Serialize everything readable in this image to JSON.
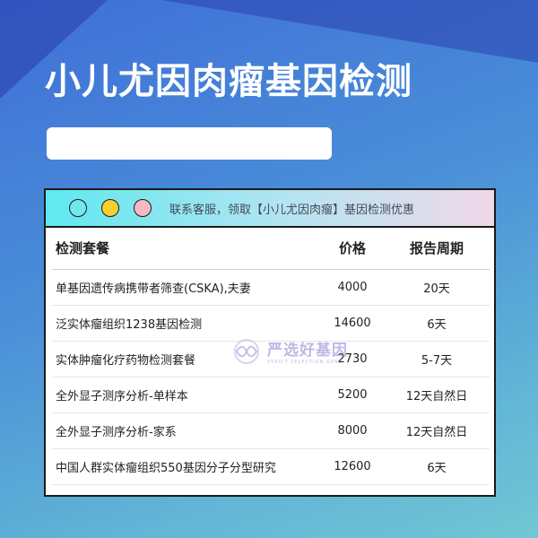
{
  "page": {
    "title": "小儿尤因肉瘤基因检测",
    "subtitle": ""
  },
  "card": {
    "header_text": "联系客服，领取【小儿尤因肉瘤】基因检测优惠",
    "table": {
      "headers": [
        "检测套餐",
        "价格",
        "报告周期"
      ],
      "rows": [
        [
          "单基因遗传病携带者筛查(CSKA),夫妻",
          "4000",
          "20天"
        ],
        [
          "泛实体瘤组织1238基因检测",
          "14600",
          "6天"
        ],
        [
          "实体肿瘤化疗药物检测套餐",
          "2730",
          "5-7天"
        ],
        [
          "全外显子测序分析-单样本",
          "5200",
          "12天自然日"
        ],
        [
          "全外显子测序分析-家系",
          "8000",
          "12天自然日"
        ],
        [
          "中国人群实体瘤组织550基因分子分型研究",
          "12600",
          "6天"
        ]
      ]
    }
  },
  "watermark": {
    "text": "严选好基因",
    "sub": "STRICT SELECTION GENE"
  },
  "colors": {
    "title": "#ffffff",
    "dot1": "#6fe9ee",
    "dot2": "#f6d02e",
    "dot3": "#f6b9c3",
    "watermark": "#8c7fd0"
  }
}
